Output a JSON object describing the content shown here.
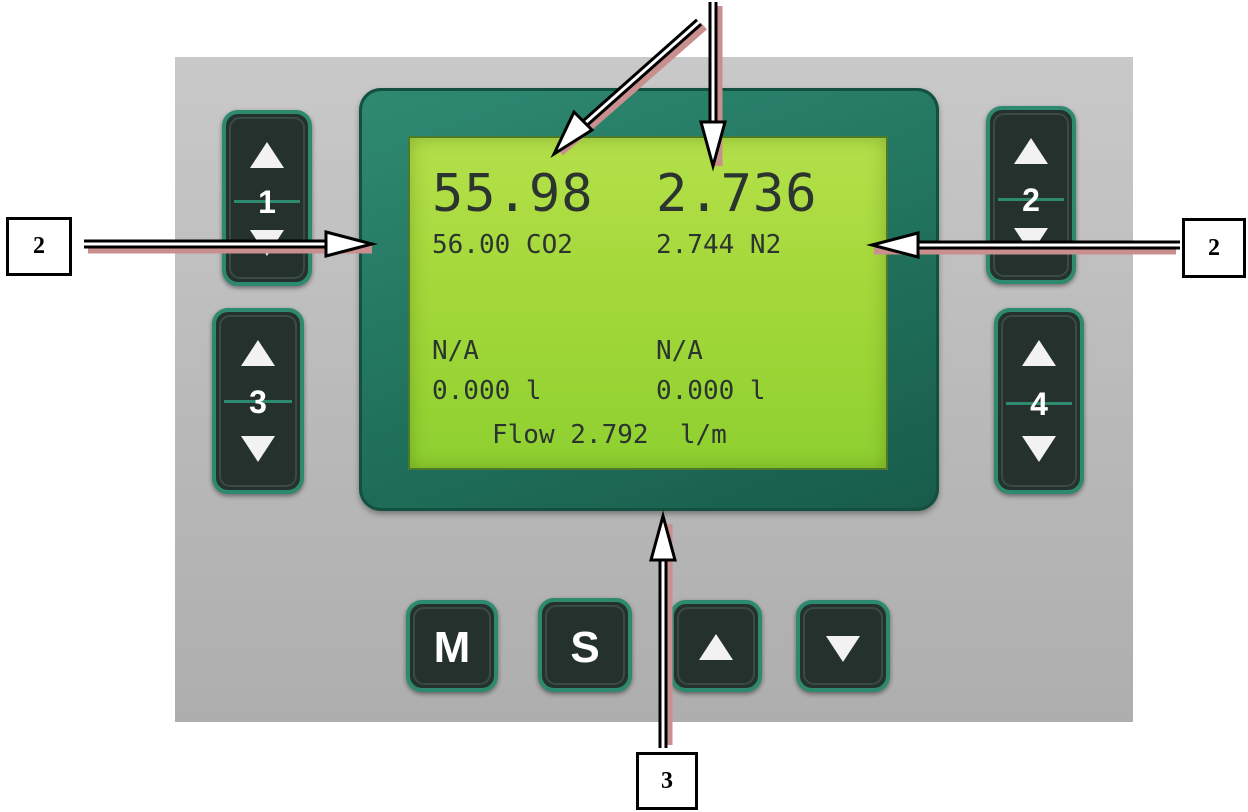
{
  "display": {
    "big_left": "55.98",
    "big_right": "2.736",
    "set_left": "56.00 CO2",
    "set_right": "2.744 N2",
    "ch3_status": "N/A",
    "ch4_status": "N/A",
    "ch3_volume": "0.000 l",
    "ch4_volume": "0.000 l",
    "flow": "Flow 2.792  l/m"
  },
  "keys": {
    "ch1": "1",
    "ch2": "2",
    "ch3": "3",
    "ch4": "4",
    "mode": "M",
    "select": "S"
  },
  "callouts": {
    "left": "2",
    "right": "2",
    "bottom": "3"
  },
  "colors": {
    "lcd": "#a4d83a",
    "bezel": "#1f6f5a",
    "key_border": "#2d8a6f"
  }
}
